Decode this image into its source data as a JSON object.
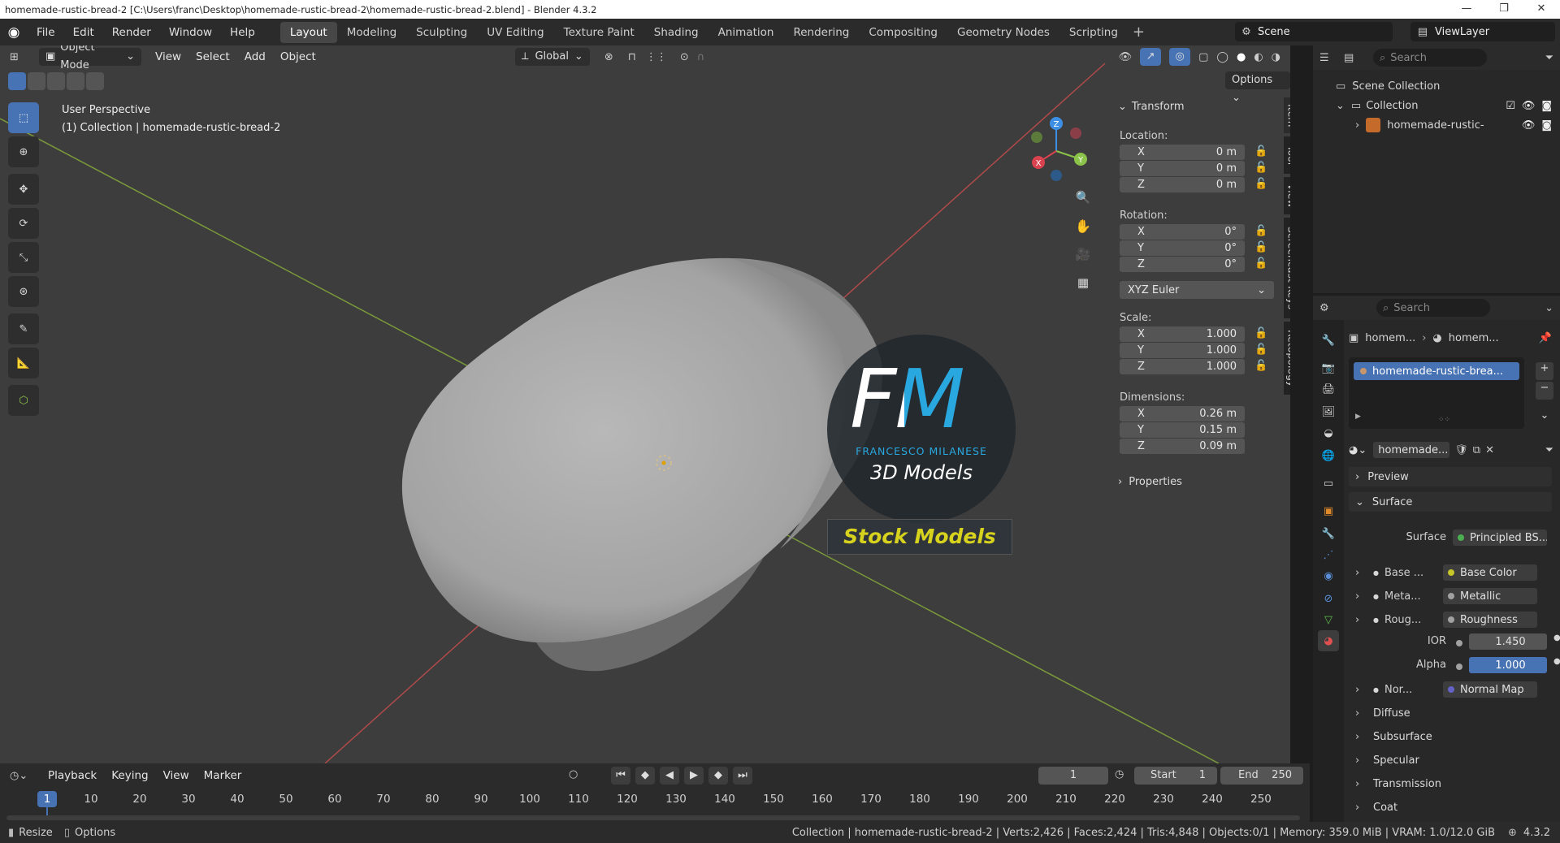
{
  "window": {
    "title": "homemade-rustic-bread-2 [C:\\Users\\franc\\Desktop\\homemade-rustic-bread-2\\homemade-rustic-bread-2.blend] - Blender 4.3.2"
  },
  "menu": [
    "File",
    "Edit",
    "Render",
    "Window",
    "Help"
  ],
  "workspaces": [
    "Layout",
    "Modeling",
    "Sculpting",
    "UV Editing",
    "Texture Paint",
    "Shading",
    "Animation",
    "Rendering",
    "Compositing",
    "Geometry Nodes",
    "Scripting"
  ],
  "scene": {
    "name": "Scene",
    "view_layer": "ViewLayer"
  },
  "viewport": {
    "mode": "Object Mode",
    "menus": [
      "View",
      "Select",
      "Add",
      "Object"
    ],
    "orientation": "Global",
    "options_label": "Options",
    "overlay_title": "User Perspective",
    "overlay_subtitle": "(1) Collection | homemade-rustic-bread-2"
  },
  "gizmo": {
    "x": "X",
    "y": "Y",
    "z": "Z"
  },
  "watermark": {
    "logo_text": "FM",
    "brand_line": "FRANCESCO MILANESE",
    "sub_line": "3D Models",
    "banner": "Stock Models"
  },
  "npanel": {
    "tabs": [
      "Item",
      "Tool",
      "View",
      "Screencast Keys",
      "Retopology"
    ],
    "transform_header": "Transform",
    "location_label": "Location:",
    "location": [
      {
        "axis": "X",
        "value": "0 m"
      },
      {
        "axis": "Y",
        "value": "0 m"
      },
      {
        "axis": "Z",
        "value": "0 m"
      }
    ],
    "rotation_label": "Rotation:",
    "rotation": [
      {
        "axis": "X",
        "value": "0°"
      },
      {
        "axis": "Y",
        "value": "0°"
      },
      {
        "axis": "Z",
        "value": "0°"
      }
    ],
    "rotation_mode": "XYZ Euler",
    "scale_label": "Scale:",
    "scale": [
      {
        "axis": "X",
        "value": "1.000"
      },
      {
        "axis": "Y",
        "value": "1.000"
      },
      {
        "axis": "Z",
        "value": "1.000"
      }
    ],
    "dimensions_label": "Dimensions:",
    "dimensions": [
      {
        "axis": "X",
        "value": "0.26 m"
      },
      {
        "axis": "Y",
        "value": "0.15 m"
      },
      {
        "axis": "Z",
        "value": "0.09 m"
      }
    ],
    "properties_header": "Properties"
  },
  "outliner": {
    "search_placeholder": "Search",
    "items": [
      {
        "label": "Scene Collection"
      },
      {
        "label": "Collection"
      },
      {
        "label": "homemade-rustic-"
      }
    ]
  },
  "properties": {
    "search_placeholder": "Search",
    "breadcrumb": [
      "homem...",
      "homem..."
    ],
    "material_slot": "homemade-rustic-brea...",
    "material_name": "homemade...",
    "preview": "Preview",
    "surface_section": "Surface",
    "surface_label": "Surface",
    "surface_value": "Principled BS...",
    "inputs": [
      {
        "label": "Base ...",
        "value": "Base Color",
        "dot": "#c7c729"
      },
      {
        "label": "Meta...",
        "value": "Metallic",
        "dot": "#a1a1a1"
      },
      {
        "label": "Roug...",
        "value": "Roughness",
        "dot": "#a1a1a1"
      }
    ],
    "ior_label": "IOR",
    "ior_value": "1.450",
    "alpha_label": "Alpha",
    "alpha_value": "1.000",
    "normal_label": "Nor...",
    "normal_value": "Normal Map",
    "sections": [
      "Diffuse",
      "Subsurface",
      "Specular",
      "Transmission",
      "Coat"
    ]
  },
  "timeline": {
    "menus": [
      "Playback",
      "Keying",
      "View",
      "Marker"
    ],
    "current_frame": "1",
    "start_label": "Start",
    "start": "1",
    "end_label": "End",
    "end": "250",
    "ticks": [
      "1",
      "10",
      "20",
      "30",
      "40",
      "50",
      "60",
      "70",
      "80",
      "90",
      "100",
      "110",
      "120",
      "130",
      "140",
      "150",
      "160",
      "170",
      "180",
      "190",
      "200",
      "210",
      "220",
      "230",
      "240",
      "250"
    ]
  },
  "status": {
    "left": [
      "Resize",
      "Options"
    ],
    "info": "Collection | homemade-rustic-bread-2 | Verts:2,426 | Faces:2,424 | Tris:4,848 | Objects:0/1 | Memory: 359.0 MiB | VRAM: 1.0/12.0 GiB",
    "version": "4.3.2"
  },
  "colors": {
    "accent": "#4772b3",
    "x_axis": "#d9424f",
    "y_axis": "#8bc34a",
    "z_axis": "#3c8fe5",
    "logo_blue": "#29a8e0",
    "banner_yellow": "#d7d21e"
  }
}
